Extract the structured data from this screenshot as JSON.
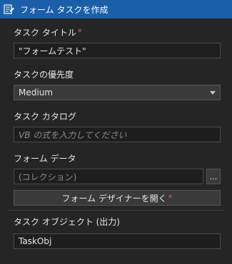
{
  "header": {
    "title": "フォーム タスクを作成",
    "icon": "form-task-icon"
  },
  "fields": {
    "task_title": {
      "label": "タスク タイトル",
      "required_mark": "*",
      "value": "\"フォームテスト\""
    },
    "priority": {
      "label": "タスクの優先度",
      "value": "Medium"
    },
    "catalog": {
      "label": "タスク カタログ",
      "placeholder": "VB の式を入力してください"
    },
    "form_data": {
      "label": "フォーム データ",
      "value": "(コレクション)",
      "browse_label": "..."
    },
    "designer": {
      "label": "フォーム デザイナーを開く",
      "required_mark": "*"
    },
    "task_object": {
      "label": "タスク オブジェクト (出力)",
      "value": "TaskObj"
    }
  },
  "colors": {
    "header_bg": "#1a5fa8",
    "panel_bg": "#252526",
    "required": "#e05757"
  }
}
